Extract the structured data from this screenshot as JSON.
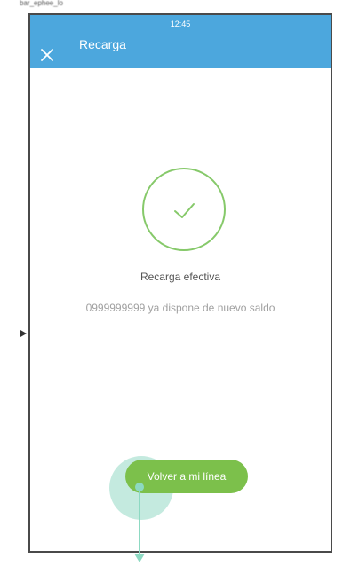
{
  "window": {
    "caption": "bar_ephee_lo"
  },
  "status_bar": {
    "time": "12:45"
  },
  "header": {
    "title": "Recarga",
    "close_icon": "close-icon",
    "color": "#4ca7dd"
  },
  "result": {
    "icon": "checkmark-circle-icon",
    "title": "Recarga efectiva",
    "message": "0999999999 ya dispone de nuevo saldo",
    "accent_color": "#86c96a"
  },
  "actions": {
    "primary_label": "Volver a mi línea",
    "primary_color": "#7cc04b"
  }
}
